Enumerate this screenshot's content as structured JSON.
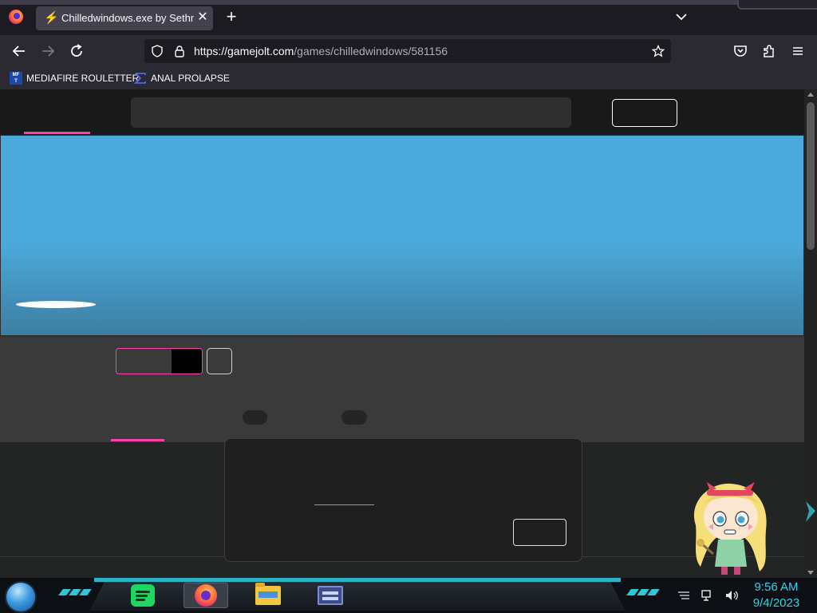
{
  "browser": {
    "tab": {
      "title": "Chilledwindows.exe by Sethnoo",
      "favicon": "gamejolt-bolt-icon"
    },
    "url": {
      "host": "https://gamejolt.com",
      "path": "/games/chilledwindows/581156"
    },
    "bookmarks": [
      {
        "label": "MEDIAFIRE ROULETTER",
        "icon": "mediafire-icon"
      },
      {
        "label": "ANAL PROLAPSE",
        "icon": "sigma-icon"
      }
    ]
  },
  "taskbar": {
    "clock": {
      "time": "9:56 AM",
      "date": "9/4/2023"
    },
    "apps": [
      "spotify",
      "firefox",
      "file-explorer",
      "media-player"
    ]
  },
  "colors": {
    "accent_pink": "#ff3fac",
    "banner_blue": "#4ba8da",
    "taskbar_cyan": "#2fc4d6"
  }
}
